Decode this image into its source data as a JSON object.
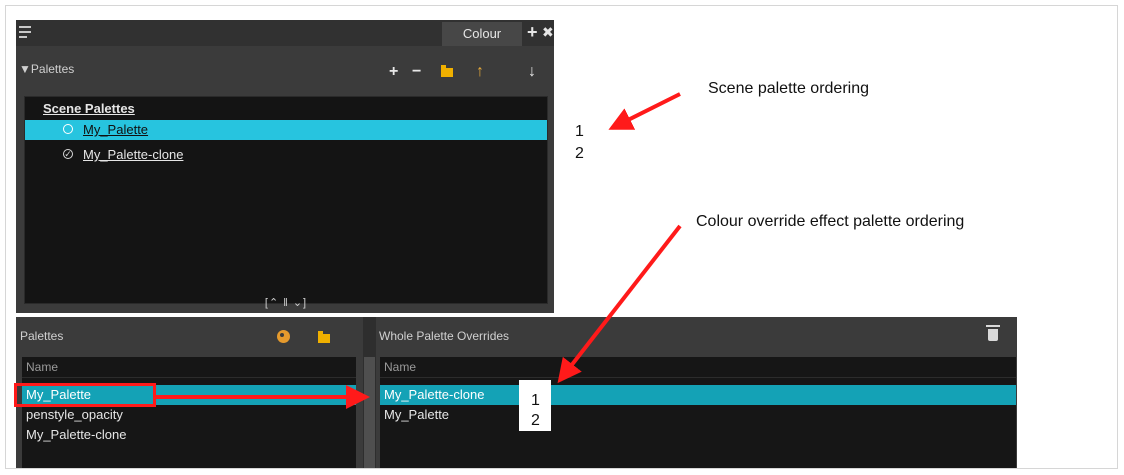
{
  "colour_panel": {
    "tab_label": "Colour",
    "add_tab_glyph": "+",
    "close_glyph": "✖",
    "section_label": "Palettes",
    "toolbar": {
      "add": "+",
      "remove": "−",
      "move_up": "↑",
      "move_down": "↓"
    },
    "scene_palettes_title": "Scene Palettes",
    "scene_palettes": [
      "My_Palette",
      "My_Palette-clone"
    ],
    "handle_glyphs": "[⌃ ‖ ⌄]"
  },
  "palettes_panel": {
    "title": "Palettes",
    "column_header": "Name",
    "items": [
      "My_Palette",
      "penstyle_opacity",
      "My_Palette-clone"
    ]
  },
  "overrides_panel": {
    "title": "Whole Palette Overrides",
    "column_header": "Name",
    "items": [
      "My_Palette-clone",
      "My_Palette"
    ]
  },
  "annotations": {
    "scene_ordering": "Scene palette ordering",
    "override_ordering": "Colour override effect palette ordering",
    "scene_numbers": [
      "1",
      "2"
    ],
    "override_numbers": [
      "1",
      "2"
    ]
  },
  "colors": {
    "selection_cyan": "#27c4df",
    "selection_teal": "#14a2b6",
    "annotation_red": "#ff1a1a",
    "panel_bg": "#3b3b3b",
    "list_bg": "#141414"
  },
  "icons": [
    "menu-icon",
    "add-icon",
    "close-icon",
    "folder-icon",
    "arrow-up-icon",
    "arrow-down-icon",
    "palette-icon",
    "trash-icon",
    "radio-icon",
    "check-icon"
  ]
}
